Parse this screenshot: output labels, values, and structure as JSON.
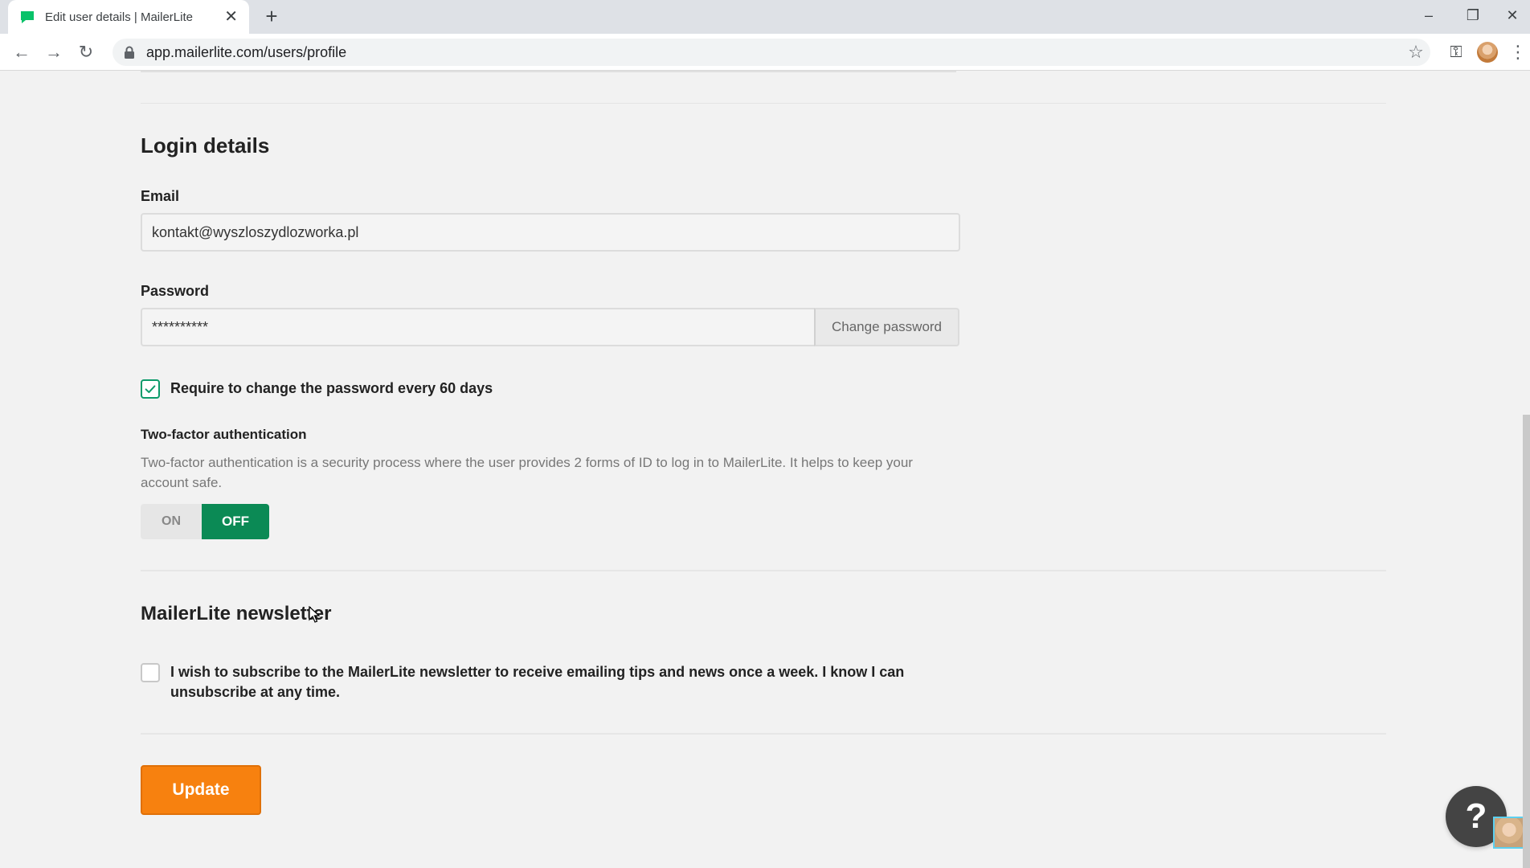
{
  "browser": {
    "tab_title": "Edit user details | MailerLite",
    "tab_close": "✕",
    "new_tab": "+",
    "url": "app.mailerlite.com/users/profile",
    "window_controls": {
      "minimize": "–",
      "maximize": "❐",
      "close": "✕"
    },
    "nav": {
      "back": "←",
      "forward": "→",
      "reload": "↻"
    },
    "star": "☆",
    "key": "⚿",
    "menu": "⋮"
  },
  "login": {
    "heading": "Login details",
    "email_label": "Email",
    "email_value": "kontakt@wyszloszydlozworka.pl",
    "password_label": "Password",
    "password_value": "**********",
    "change_password_label": "Change password",
    "require_change_label": "Require to change the password every 60 days",
    "require_change_checked": true,
    "two_factor_title": "Two-factor authentication",
    "two_factor_desc": "Two-factor authentication is a security process where the user provides 2 forms of ID to log in to MailerLite. It helps to keep your account safe.",
    "toggle_on": "ON",
    "toggle_off": "OFF",
    "toggle_state": "off"
  },
  "newsletter": {
    "heading": "MailerLite newsletter",
    "subscribe_label": "I wish to subscribe to the MailerLite newsletter to receive emailing tips and news once a week. I know I can unsubscribe at any time.",
    "subscribe_checked": false
  },
  "actions": {
    "update_label": "Update"
  },
  "help": {
    "label": "?"
  },
  "colors": {
    "accent_green": "#0b8a55",
    "checkbox_green": "#0d9b6b",
    "update_orange": "#f7810f"
  }
}
